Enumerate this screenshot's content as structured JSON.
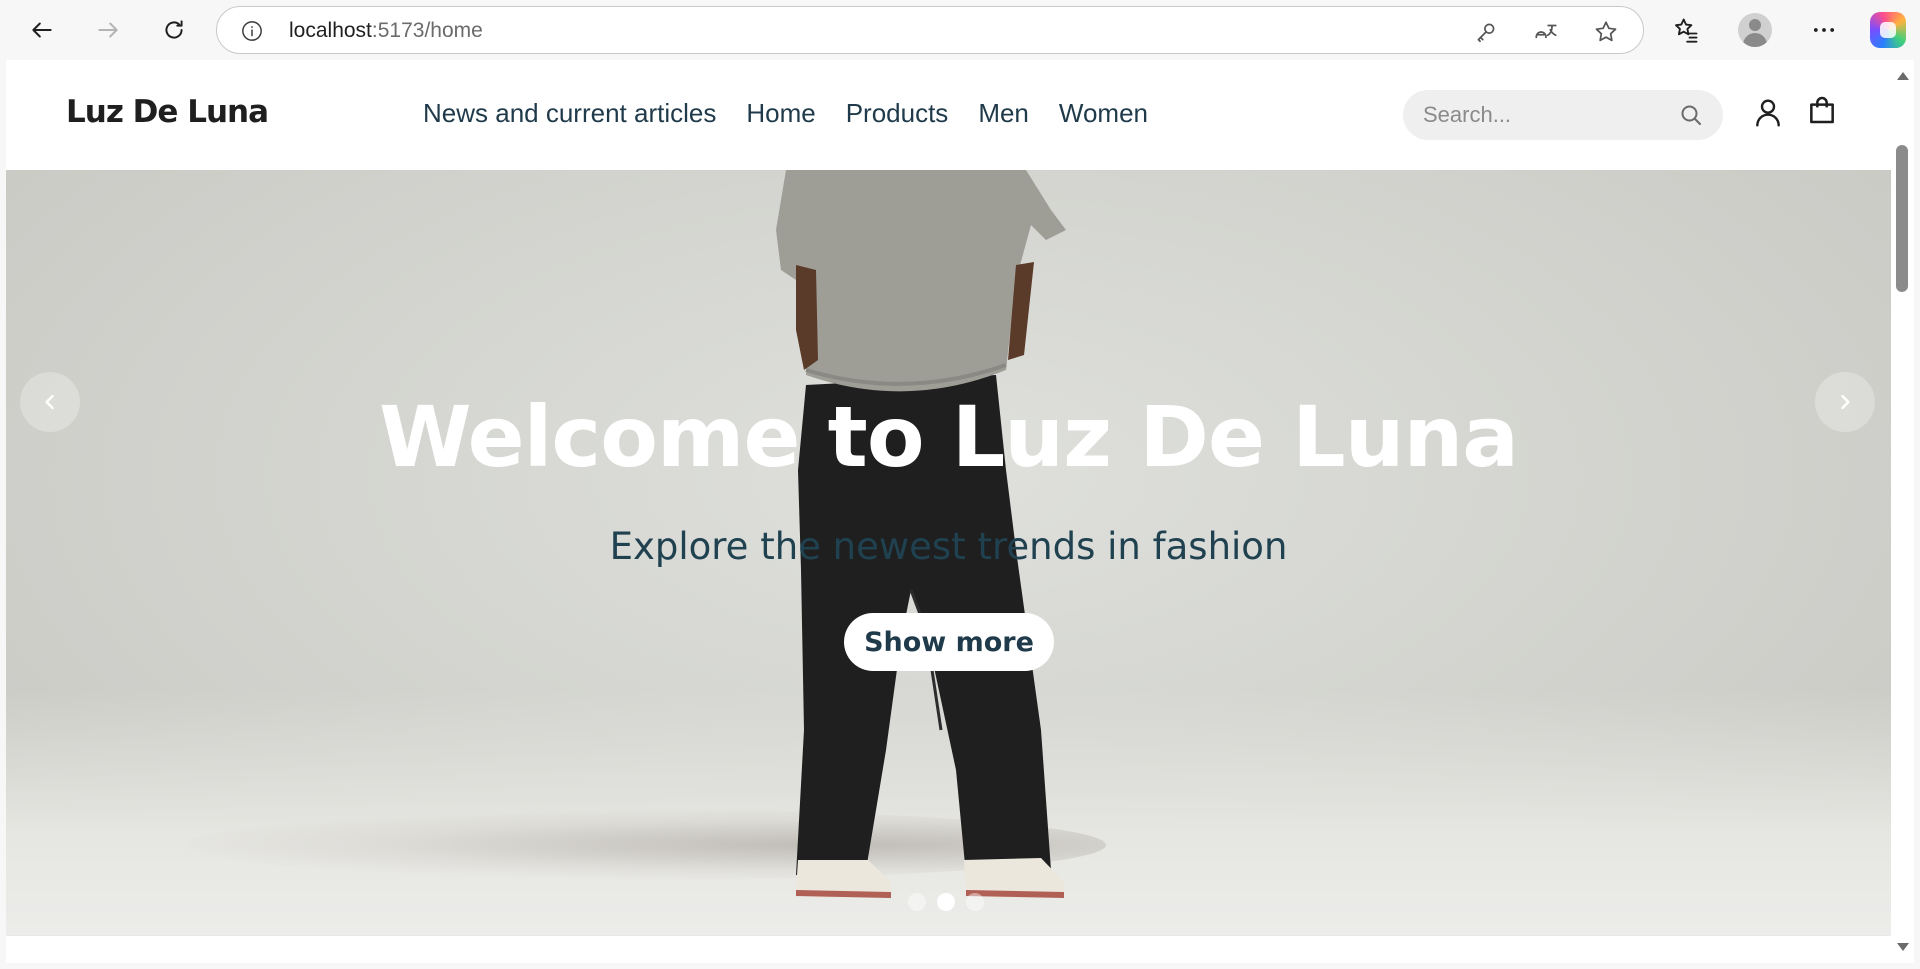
{
  "browser": {
    "url_host": "localhost",
    "url_path": ":5173/home"
  },
  "site": {
    "logo": "Luz De Luna",
    "nav": [
      "News and current articles",
      "Home",
      "Products",
      "Men",
      "Women"
    ],
    "search_placeholder": "Search...",
    "colors": {
      "nav_text": "#1f3a4a",
      "subtitle": "#1f4150"
    }
  },
  "hero": {
    "title": "Welcome to Luz De Luna",
    "subtitle": "Explore the newest trends in fashion",
    "button": "Show more",
    "slides_total": 3,
    "active_slide": 2
  }
}
